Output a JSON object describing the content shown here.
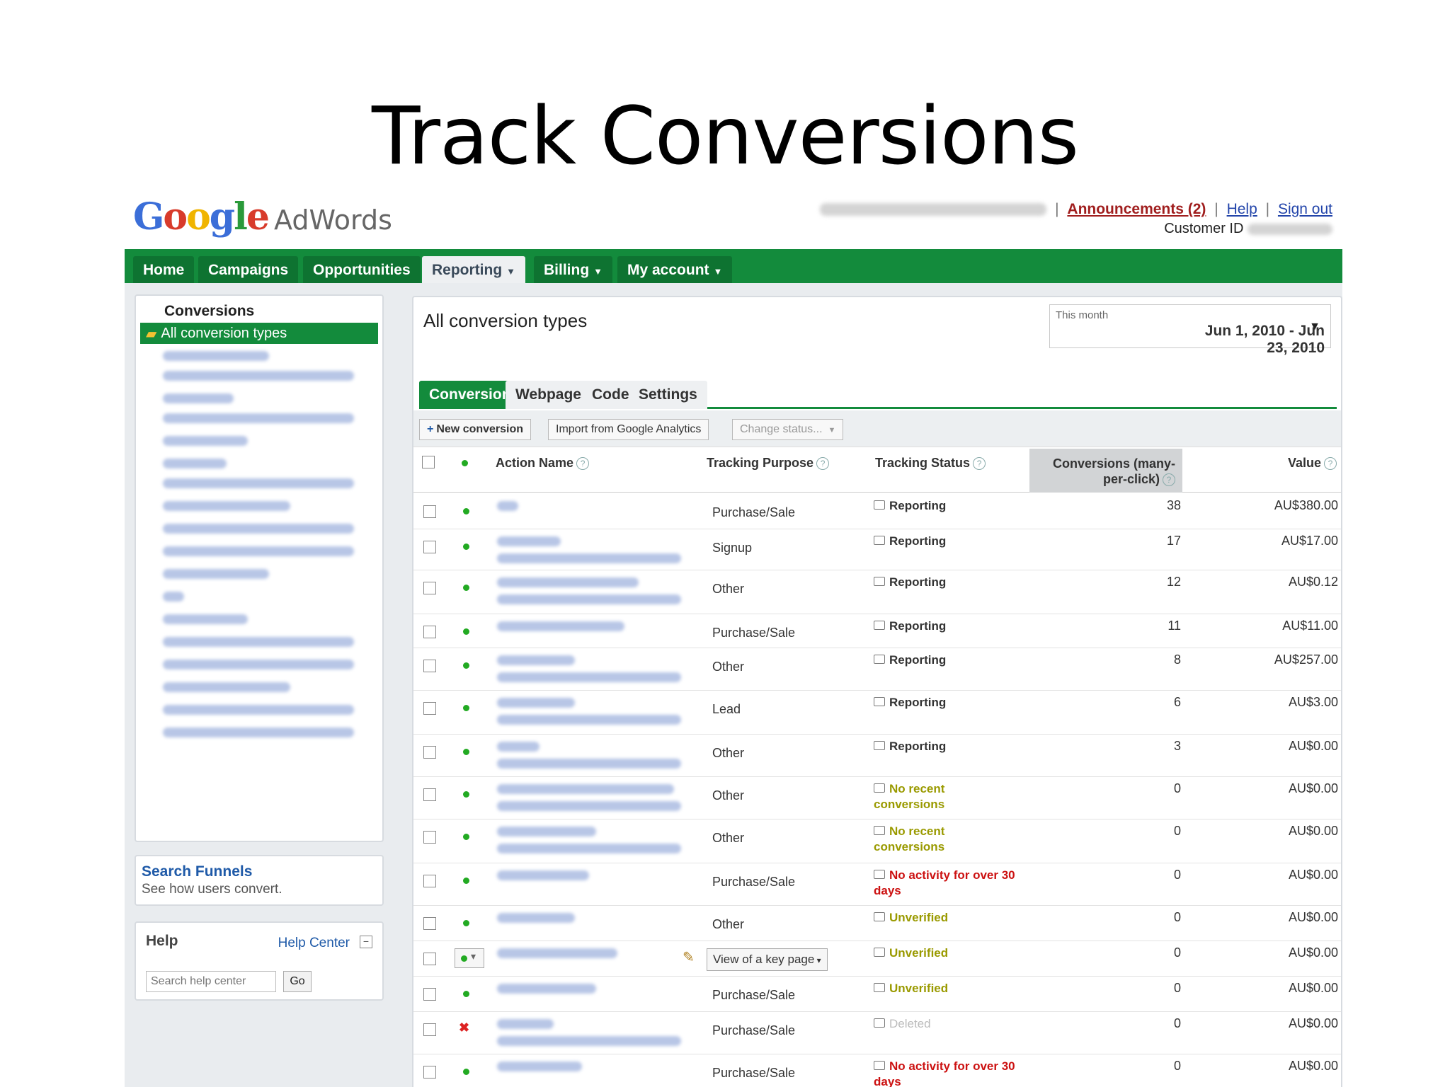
{
  "slide_title": "Track Conversions",
  "header": {
    "logo_google": "Google",
    "logo_adwords": "AdWords",
    "announcements": "Announcements (2)",
    "help": "Help",
    "sign_out": "Sign out",
    "customer_id_label": "Customer ID"
  },
  "nav": {
    "tabs": [
      {
        "label": "Home"
      },
      {
        "label": "Campaigns"
      },
      {
        "label": "Opportunities"
      },
      {
        "label": "Reporting",
        "active": true
      },
      {
        "label": "Billing"
      },
      {
        "label": "My account"
      }
    ]
  },
  "sidebar": {
    "conversions_header": "Conversions",
    "selected_item": "All conversion types",
    "funnels_title": "Search Funnels",
    "funnels_sub": "See how users convert.",
    "help_title": "Help",
    "help_center": "Help Center",
    "help_minimize": "−",
    "search_placeholder": "Search help center",
    "go_label": "Go"
  },
  "main": {
    "title": "All conversion types",
    "date_label": "This month",
    "date_range": "Jun 1, 2010 - Jun 23, 2010",
    "subtabs": [
      "Conversions",
      "Webpages",
      "Code",
      "Settings"
    ],
    "toolbar": {
      "new_conversion": "New conversion",
      "import": "Import from Google Analytics",
      "change_status": "Change status..."
    },
    "columns": {
      "action_name": "Action Name",
      "tracking_purpose": "Tracking Purpose",
      "tracking_status": "Tracking Status",
      "conversions": "Conversions (many-per-click)",
      "conversions_l1": "Conversions (many-",
      "conversions_l2": "per-click)",
      "value": "Value"
    },
    "rows": [
      {
        "purpose": "Purchase/Sale",
        "status": "Reporting",
        "status_class": "reporting",
        "conversions": "38",
        "value": "AU$380.00"
      },
      {
        "purpose": "Signup",
        "status": "Reporting",
        "status_class": "reporting",
        "conversions": "17",
        "value": "AU$17.00"
      },
      {
        "purpose": "Other",
        "status": "Reporting",
        "status_class": "reporting",
        "conversions": "12",
        "value": "AU$0.12"
      },
      {
        "purpose": "Purchase/Sale",
        "status": "Reporting",
        "status_class": "reporting",
        "conversions": "11",
        "value": "AU$11.00"
      },
      {
        "purpose": "Other",
        "status": "Reporting",
        "status_class": "reporting",
        "conversions": "8",
        "value": "AU$257.00"
      },
      {
        "purpose": "Lead",
        "status": "Reporting",
        "status_class": "reporting",
        "conversions": "6",
        "value": "AU$3.00"
      },
      {
        "purpose": "Other",
        "status": "Reporting",
        "status_class": "reporting",
        "conversions": "3",
        "value": "AU$0.00"
      },
      {
        "purpose": "Other",
        "status": "No recent conversions",
        "status_class": "norecent",
        "conversions": "0",
        "value": "AU$0.00"
      },
      {
        "purpose": "Other",
        "status": "No recent conversions",
        "status_class": "norecent",
        "conversions": "0",
        "value": "AU$0.00"
      },
      {
        "purpose": "Purchase/Sale",
        "status": "No activity for over 30 days",
        "status_class": "noactivity",
        "conversions": "0",
        "value": "AU$0.00"
      },
      {
        "purpose": "Other",
        "status": "Unverified",
        "status_class": "unverified",
        "conversions": "0",
        "value": "AU$0.00"
      },
      {
        "purpose": "View of a key page",
        "status": "Unverified",
        "status_class": "unverified",
        "conversions": "0",
        "value": "AU$0.00",
        "editing": true
      },
      {
        "purpose": "Purchase/Sale",
        "status": "Unverified",
        "status_class": "unverified",
        "conversions": "0",
        "value": "AU$0.00"
      },
      {
        "purpose": "Purchase/Sale",
        "status": "Deleted",
        "status_class": "deleted",
        "conversions": "0",
        "value": "AU$0.00",
        "deleted": true
      },
      {
        "purpose": "Purchase/Sale",
        "status": "No activity for over 30 days",
        "status_class": "noactivity",
        "conversions": "0",
        "value": "AU$0.00"
      }
    ]
  },
  "colors": {
    "nav_green": "#138b3c",
    "status_red": "#cc1111",
    "status_olive": "#9a9a00",
    "link_blue": "#2244aa",
    "announce_red": "#a01e1e"
  }
}
